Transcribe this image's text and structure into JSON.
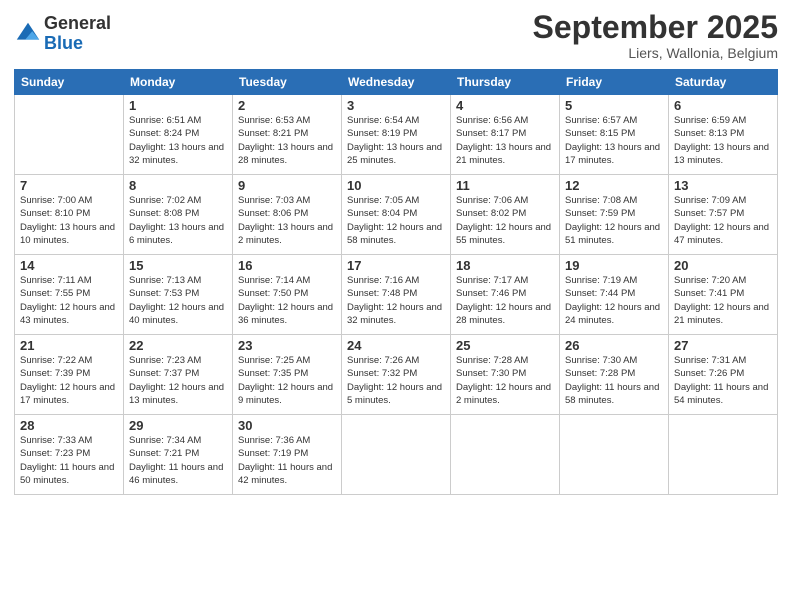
{
  "logo": {
    "general": "General",
    "blue": "Blue"
  },
  "header": {
    "month": "September 2025",
    "location": "Liers, Wallonia, Belgium"
  },
  "weekdays": [
    "Sunday",
    "Monday",
    "Tuesday",
    "Wednesday",
    "Thursday",
    "Friday",
    "Saturday"
  ],
  "weeks": [
    [
      {
        "day": "",
        "sunrise": "",
        "sunset": "",
        "daylight": ""
      },
      {
        "day": "1",
        "sunrise": "Sunrise: 6:51 AM",
        "sunset": "Sunset: 8:24 PM",
        "daylight": "Daylight: 13 hours and 32 minutes."
      },
      {
        "day": "2",
        "sunrise": "Sunrise: 6:53 AM",
        "sunset": "Sunset: 8:21 PM",
        "daylight": "Daylight: 13 hours and 28 minutes."
      },
      {
        "day": "3",
        "sunrise": "Sunrise: 6:54 AM",
        "sunset": "Sunset: 8:19 PM",
        "daylight": "Daylight: 13 hours and 25 minutes."
      },
      {
        "day": "4",
        "sunrise": "Sunrise: 6:56 AM",
        "sunset": "Sunset: 8:17 PM",
        "daylight": "Daylight: 13 hours and 21 minutes."
      },
      {
        "day": "5",
        "sunrise": "Sunrise: 6:57 AM",
        "sunset": "Sunset: 8:15 PM",
        "daylight": "Daylight: 13 hours and 17 minutes."
      },
      {
        "day": "6",
        "sunrise": "Sunrise: 6:59 AM",
        "sunset": "Sunset: 8:13 PM",
        "daylight": "Daylight: 13 hours and 13 minutes."
      }
    ],
    [
      {
        "day": "7",
        "sunrise": "Sunrise: 7:00 AM",
        "sunset": "Sunset: 8:10 PM",
        "daylight": "Daylight: 13 hours and 10 minutes."
      },
      {
        "day": "8",
        "sunrise": "Sunrise: 7:02 AM",
        "sunset": "Sunset: 8:08 PM",
        "daylight": "Daylight: 13 hours and 6 minutes."
      },
      {
        "day": "9",
        "sunrise": "Sunrise: 7:03 AM",
        "sunset": "Sunset: 8:06 PM",
        "daylight": "Daylight: 13 hours and 2 minutes."
      },
      {
        "day": "10",
        "sunrise": "Sunrise: 7:05 AM",
        "sunset": "Sunset: 8:04 PM",
        "daylight": "Daylight: 12 hours and 58 minutes."
      },
      {
        "day": "11",
        "sunrise": "Sunrise: 7:06 AM",
        "sunset": "Sunset: 8:02 PM",
        "daylight": "Daylight: 12 hours and 55 minutes."
      },
      {
        "day": "12",
        "sunrise": "Sunrise: 7:08 AM",
        "sunset": "Sunset: 7:59 PM",
        "daylight": "Daylight: 12 hours and 51 minutes."
      },
      {
        "day": "13",
        "sunrise": "Sunrise: 7:09 AM",
        "sunset": "Sunset: 7:57 PM",
        "daylight": "Daylight: 12 hours and 47 minutes."
      }
    ],
    [
      {
        "day": "14",
        "sunrise": "Sunrise: 7:11 AM",
        "sunset": "Sunset: 7:55 PM",
        "daylight": "Daylight: 12 hours and 43 minutes."
      },
      {
        "day": "15",
        "sunrise": "Sunrise: 7:13 AM",
        "sunset": "Sunset: 7:53 PM",
        "daylight": "Daylight: 12 hours and 40 minutes."
      },
      {
        "day": "16",
        "sunrise": "Sunrise: 7:14 AM",
        "sunset": "Sunset: 7:50 PM",
        "daylight": "Daylight: 12 hours and 36 minutes."
      },
      {
        "day": "17",
        "sunrise": "Sunrise: 7:16 AM",
        "sunset": "Sunset: 7:48 PM",
        "daylight": "Daylight: 12 hours and 32 minutes."
      },
      {
        "day": "18",
        "sunrise": "Sunrise: 7:17 AM",
        "sunset": "Sunset: 7:46 PM",
        "daylight": "Daylight: 12 hours and 28 minutes."
      },
      {
        "day": "19",
        "sunrise": "Sunrise: 7:19 AM",
        "sunset": "Sunset: 7:44 PM",
        "daylight": "Daylight: 12 hours and 24 minutes."
      },
      {
        "day": "20",
        "sunrise": "Sunrise: 7:20 AM",
        "sunset": "Sunset: 7:41 PM",
        "daylight": "Daylight: 12 hours and 21 minutes."
      }
    ],
    [
      {
        "day": "21",
        "sunrise": "Sunrise: 7:22 AM",
        "sunset": "Sunset: 7:39 PM",
        "daylight": "Daylight: 12 hours and 17 minutes."
      },
      {
        "day": "22",
        "sunrise": "Sunrise: 7:23 AM",
        "sunset": "Sunset: 7:37 PM",
        "daylight": "Daylight: 12 hours and 13 minutes."
      },
      {
        "day": "23",
        "sunrise": "Sunrise: 7:25 AM",
        "sunset": "Sunset: 7:35 PM",
        "daylight": "Daylight: 12 hours and 9 minutes."
      },
      {
        "day": "24",
        "sunrise": "Sunrise: 7:26 AM",
        "sunset": "Sunset: 7:32 PM",
        "daylight": "Daylight: 12 hours and 5 minutes."
      },
      {
        "day": "25",
        "sunrise": "Sunrise: 7:28 AM",
        "sunset": "Sunset: 7:30 PM",
        "daylight": "Daylight: 12 hours and 2 minutes."
      },
      {
        "day": "26",
        "sunrise": "Sunrise: 7:30 AM",
        "sunset": "Sunset: 7:28 PM",
        "daylight": "Daylight: 11 hours and 58 minutes."
      },
      {
        "day": "27",
        "sunrise": "Sunrise: 7:31 AM",
        "sunset": "Sunset: 7:26 PM",
        "daylight": "Daylight: 11 hours and 54 minutes."
      }
    ],
    [
      {
        "day": "28",
        "sunrise": "Sunrise: 7:33 AM",
        "sunset": "Sunset: 7:23 PM",
        "daylight": "Daylight: 11 hours and 50 minutes."
      },
      {
        "day": "29",
        "sunrise": "Sunrise: 7:34 AM",
        "sunset": "Sunset: 7:21 PM",
        "daylight": "Daylight: 11 hours and 46 minutes."
      },
      {
        "day": "30",
        "sunrise": "Sunrise: 7:36 AM",
        "sunset": "Sunset: 7:19 PM",
        "daylight": "Daylight: 11 hours and 42 minutes."
      },
      {
        "day": "",
        "sunrise": "",
        "sunset": "",
        "daylight": ""
      },
      {
        "day": "",
        "sunrise": "",
        "sunset": "",
        "daylight": ""
      },
      {
        "day": "",
        "sunrise": "",
        "sunset": "",
        "daylight": ""
      },
      {
        "day": "",
        "sunrise": "",
        "sunset": "",
        "daylight": ""
      }
    ]
  ]
}
